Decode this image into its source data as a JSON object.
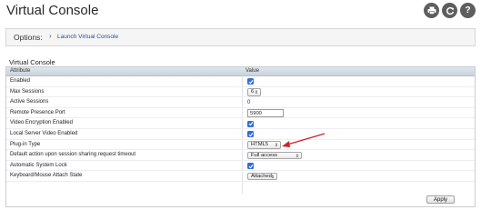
{
  "header": {
    "title": "Virtual Console",
    "icons": [
      "print-icon",
      "refresh-icon",
      "help-icon"
    ],
    "help_glyph": "?"
  },
  "options": {
    "label": "Options:",
    "separator": "›",
    "link": "Launch Virtual Console"
  },
  "section": {
    "title": "Virtual Console"
  },
  "table": {
    "columns": [
      "Attribute",
      "Value"
    ],
    "rows": [
      {
        "attribute": "Enabled",
        "type": "checkbox",
        "checked": true
      },
      {
        "attribute": "Max Sessions",
        "type": "select",
        "value": "6"
      },
      {
        "attribute": "Active Sessions",
        "type": "text",
        "value": "0"
      },
      {
        "attribute": "Remote Presence Port",
        "type": "input",
        "value": "5900"
      },
      {
        "attribute": "Video Encryption Enabled",
        "type": "checkbox",
        "checked": true
      },
      {
        "attribute": "Local Server Video Enabled",
        "type": "checkbox",
        "checked": true
      },
      {
        "attribute": "Plug-in Type",
        "type": "select",
        "value": "HTML5"
      },
      {
        "attribute": "Default action upon session sharing request timeout",
        "type": "select",
        "value": "Full access"
      },
      {
        "attribute": "Automatic System Lock",
        "type": "checkbox",
        "checked": true
      },
      {
        "attribute": "Keyboard/Mouse Attach State",
        "type": "select",
        "value": "Attached"
      }
    ]
  },
  "apply_label": "Apply",
  "colors": {
    "accent": "#2f6fd6",
    "link": "#1d4f9c",
    "annotation_arrow": "#d0202a"
  }
}
